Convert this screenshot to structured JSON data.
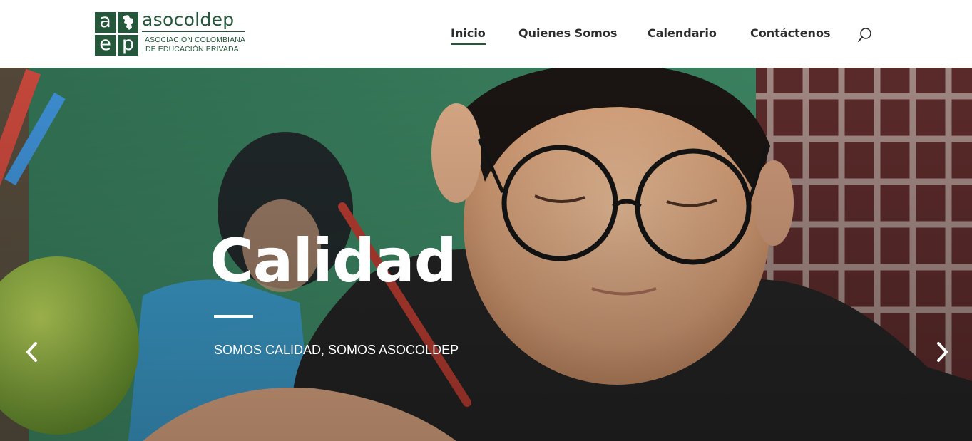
{
  "logo": {
    "cells": [
      "a",
      "",
      "e",
      "p"
    ],
    "name": "asocoldep",
    "line1": "ASOCIACIÓN COLOMBIANA",
    "line2": "DE EDUCACIÓN PRIVADA",
    "icon": "colombia-map-icon"
  },
  "nav": {
    "items": [
      {
        "label": "Inicio",
        "active": true
      },
      {
        "label": "Quienes Somos",
        "active": false
      },
      {
        "label": "Calendario",
        "active": false
      },
      {
        "label": "Contáctenos",
        "active": false
      }
    ],
    "search_icon": "search-icon"
  },
  "hero": {
    "title": "Calidad",
    "subtitle": "SOMOS CALIDAD, SOMOS ASOCOLDEP",
    "prev_icon": "chevron-left-icon",
    "next_icon": "chevron-right-icon"
  },
  "colors": {
    "brand": "#25573a",
    "nav_text": "#2c2c2c",
    "hero_text": "#ffffff"
  }
}
